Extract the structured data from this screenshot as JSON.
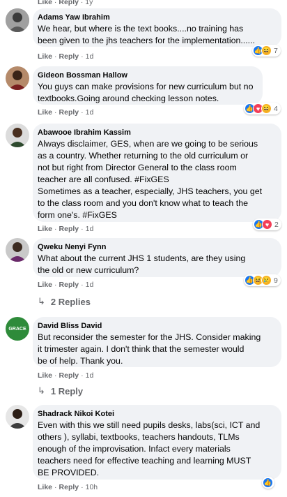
{
  "top_actions": {
    "like": "Like",
    "reply": "Reply",
    "time": "1y"
  },
  "comments": [
    {
      "name": "Adams Yaw Ibrahim",
      "text": "We hear, but where is the text books....no training has\nbeen given to the jhs teachers for the implementation......",
      "like": "Like",
      "reply": "Reply",
      "time": "1d",
      "reaction_count": "7",
      "reactions": [
        "like-icon",
        "haha-icon"
      ]
    },
    {
      "name": "Gideon Bossman Hallow",
      "text": "You guys can make provisions for new curriculum but no\ntextbooks.Going around checking lesson notes.",
      "like": "Like",
      "reply": "Reply",
      "time": "1d",
      "reaction_count": "4",
      "reactions": [
        "like-icon",
        "love-icon",
        "haha-icon"
      ]
    },
    {
      "name": "Abawooe Ibrahim Kassim",
      "text": "Always disclaimer, GES, when are we going to be serious\nas a country. Whether returning to the old curriculum or\nnot but right from Director General to the class room\nteacher are all confused. #FixGES\nSometimes as a teacher, especially, JHS teachers, you get\nto the class room and you don't know what to teach the\nform one's. #FixGES",
      "like": "Like",
      "reply": "Reply",
      "time": "1d",
      "reaction_count": "2",
      "reactions": [
        "like-icon",
        "love-icon"
      ]
    },
    {
      "name": "Qweku Nenyi Fynn",
      "text": "What about the current JHS 1 students, are they using\nthe old or new curriculum?",
      "like": "Like",
      "reply": "Reply",
      "time": "1d",
      "reaction_count": "9",
      "reactions": [
        "like-icon",
        "haha-icon",
        "sad-icon"
      ],
      "replies": "2 Replies"
    },
    {
      "name": "David Bliss David",
      "text": "But reconsider the semester for the JHS. Consider making\nit trimester again. I don't think that the semester would\nbe of help. Thank you.",
      "like": "Like",
      "reply": "Reply",
      "time": "1d",
      "replies": "1 Reply",
      "avatar_text": "GRACE"
    },
    {
      "name": "Shadrack Nikoi Kotei",
      "text": "Even with this we still need pupils desks, labs(sci, ICT and\nothers ), syllabi, textbooks, teachers handouts, TLMs\nenough of the improvisation. Infact every materials\nteachers need for effective teaching and learning MUST\nBE PROVIDED.",
      "like": "Like",
      "reply": "Reply",
      "time": "10h",
      "reaction_count": "",
      "reactions": [
        "like-icon"
      ]
    }
  ],
  "colors": {
    "bubble": "#f0f2f5",
    "like": "#1877f2",
    "love": "#f33e58",
    "haha": "#f7b125",
    "meta": "#65676b"
  }
}
